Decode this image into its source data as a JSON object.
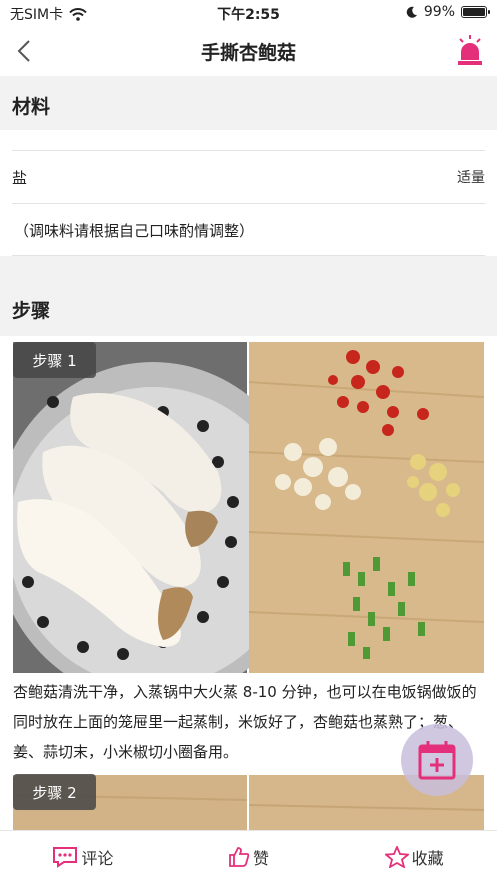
{
  "status_bar": {
    "carrier": "无SIM卡",
    "time": "下午2:55",
    "battery": "99%"
  },
  "nav": {
    "title": "手撕杏鲍菇"
  },
  "materials": {
    "header": "材料",
    "items": [
      {
        "name": "盐",
        "qty": "适量"
      }
    ],
    "note": "（调味料请根据自己口味酌情调整）"
  },
  "steps": {
    "header": "步骤",
    "items": [
      {
        "badge": "步骤 1",
        "text": "杏鲍菇清洗干净，入蒸锅中大火蒸 8-10 分钟，也可以在电饭锅做饭的同时放在上面的笼屉里一起蒸制，米饭好了，杏鲍菇也蒸熟了；葱、姜、蒜切末，小米椒切小圈备用。"
      },
      {
        "badge": "步骤 2"
      }
    ]
  },
  "tab_bar": {
    "comment": "评论",
    "like": "赞",
    "favorite": "收藏"
  },
  "colors": {
    "accent": "#e4307a",
    "section_bg": "#f2f2f2"
  }
}
